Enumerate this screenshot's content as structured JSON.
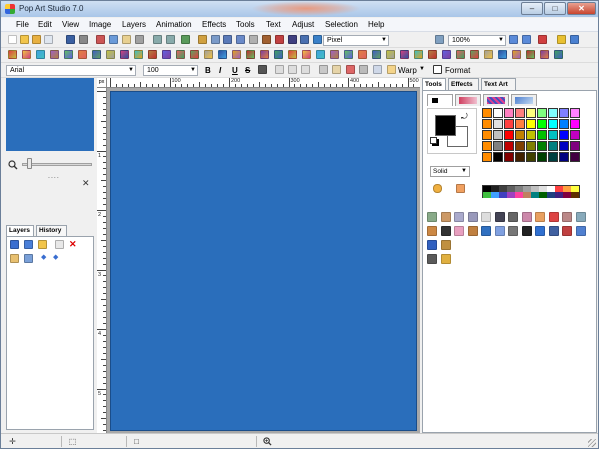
{
  "window": {
    "title": "Pop Art Studio 7.0",
    "controls": {
      "minimize": "–",
      "maximize": "□",
      "close": "✕"
    }
  },
  "menu": [
    "File",
    "Edit",
    "View",
    "Image",
    "Layers",
    "Animation",
    "Effects",
    "Tools",
    "Text",
    "Adjust",
    "Selection",
    "Help"
  ],
  "toolbar1": {
    "units_select": "Pixel",
    "zoom_select": "100%"
  },
  "toolbar3": {
    "font_select": "Arial",
    "size_select": "100",
    "bold_label": "B",
    "italic_label": "I",
    "underline_label": "U",
    "strike_label": "S",
    "warp_label": "Warp",
    "format_label": "Format"
  },
  "left_dock": {
    "dots": "....",
    "close": "✕",
    "tabs": [
      "Layers",
      "History"
    ]
  },
  "ruler": {
    "unit": "px",
    "h_labels": [
      "100",
      "200",
      "300",
      "400",
      "500"
    ],
    "v_labels": [
      "1",
      "2",
      "3",
      "4",
      "5"
    ]
  },
  "right_dock": {
    "tabs": [
      "Tools",
      "Effects",
      "Text Art"
    ],
    "fill_mode": "Solid"
  },
  "colors": {
    "canvas_blue": "#2a6ebb",
    "palette": [
      [
        "#ff8c00",
        "#ffffff",
        "#ff80c0",
        "#ff8080",
        "#ffff80",
        "#80ff80",
        "#80ffff",
        "#8080ff",
        "#ff80ff"
      ],
      [
        "#ff8c00",
        "#e0e0e0",
        "#ff4040",
        "#ff8040",
        "#ffff00",
        "#00ff00",
        "#00ffff",
        "#0080ff",
        "#ff00ff"
      ],
      [
        "#ff8c00",
        "#c0c0c0",
        "#ff0000",
        "#c08000",
        "#c0c000",
        "#00c000",
        "#00c0c0",
        "#0000ff",
        "#c000c0"
      ],
      [
        "#ff8c00",
        "#808080",
        "#c00000",
        "#804000",
        "#808000",
        "#008000",
        "#008080",
        "#0000c0",
        "#800080"
      ],
      [
        "#ff8c00",
        "#000000",
        "#800000",
        "#402000",
        "#404000",
        "#004000",
        "#004040",
        "#000080",
        "#400040"
      ]
    ],
    "strip": [
      "#000000",
      "#202020",
      "#404040",
      "#606060",
      "#808080",
      "#a0a0a0",
      "#c0c0c0",
      "#e0e0e0",
      "#ffffff",
      "#ff4040",
      "#ffa040",
      "#ffff40",
      "#40c040",
      "#40a0ff",
      "#4040c0",
      "#a040c0",
      "#ff40a0",
      "#c08060",
      "#008080",
      "#006000",
      "#204080",
      "#402080",
      "#800040",
      "#603000"
    ]
  },
  "icons": {
    "toolbar1": [
      "new-icon",
      "open-icon",
      "open-folder-icon",
      "document-icon",
      "save-icon",
      "print-icon",
      "cut-icon",
      "copy-icon",
      "paste-icon",
      "crop-icon",
      "undo-icon",
      "redo-icon",
      "refresh-icon",
      "pattern-icon",
      "resize-icon",
      "flip-icon",
      "rotate-icon",
      "grid-icon",
      "stamp-icon",
      "brush-icon",
      "pen-icon",
      "settings-icon",
      "globe-icon",
      "share-icon",
      "zoom-out-icon",
      "zoom-in-icon",
      "flag-icon",
      "help-icon",
      "info-icon"
    ],
    "toolbar2_count": 40,
    "tools": [
      "marquee-icon",
      "lasso-icon",
      "select-grid-icon",
      "ellipse-icon",
      "balloon-icon",
      "magic-wand-icon",
      "move-icon",
      "measure-icon",
      "hand-icon",
      "eyedropper-icon",
      "brush-icon",
      "clone-icon",
      "pencil-icon",
      "line-icon",
      "eraser-icon",
      "bucket-icon",
      "airbrush-icon",
      "gradient-icon",
      "smudge-icon",
      "text-icon",
      "shape-icon",
      "square-icon",
      "pattern-icon",
      "rectangle-icon"
    ]
  }
}
